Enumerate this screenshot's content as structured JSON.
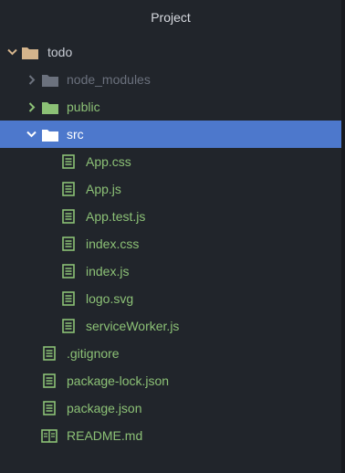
{
  "panel": {
    "title": "Project"
  },
  "tree": {
    "root": {
      "label": "todo",
      "expanded": true,
      "icon": "folder-icon"
    },
    "node_modules": {
      "label": "node_modules",
      "expanded": false,
      "icon": "folder-icon"
    },
    "public": {
      "label": "public",
      "expanded": false,
      "icon": "folder-icon"
    },
    "src": {
      "label": "src",
      "expanded": true,
      "selected": true,
      "icon": "folder-icon"
    },
    "src_files": [
      {
        "label": "App.css",
        "icon": "file-text-icon"
      },
      {
        "label": "App.js",
        "icon": "file-text-icon"
      },
      {
        "label": "App.test.js",
        "icon": "file-text-icon"
      },
      {
        "label": "index.css",
        "icon": "file-text-icon"
      },
      {
        "label": "index.js",
        "icon": "file-text-icon"
      },
      {
        "label": "logo.svg",
        "icon": "file-text-icon"
      },
      {
        "label": "serviceWorker.js",
        "icon": "file-text-icon"
      }
    ],
    "root_files": [
      {
        "label": ".gitignore",
        "icon": "file-text-icon"
      },
      {
        "label": "package-lock.json",
        "icon": "file-text-icon"
      },
      {
        "label": "package.json",
        "icon": "file-text-icon"
      },
      {
        "label": "README.md",
        "icon": "book-icon"
      }
    ]
  },
  "colors": {
    "background": "#21252b",
    "selected_row": "#4d78cc",
    "added_green": "#8cc176",
    "ignored_gray": "#6b717d",
    "folder_tan": "#d4b48c",
    "text_default": "#c8ccd4"
  }
}
